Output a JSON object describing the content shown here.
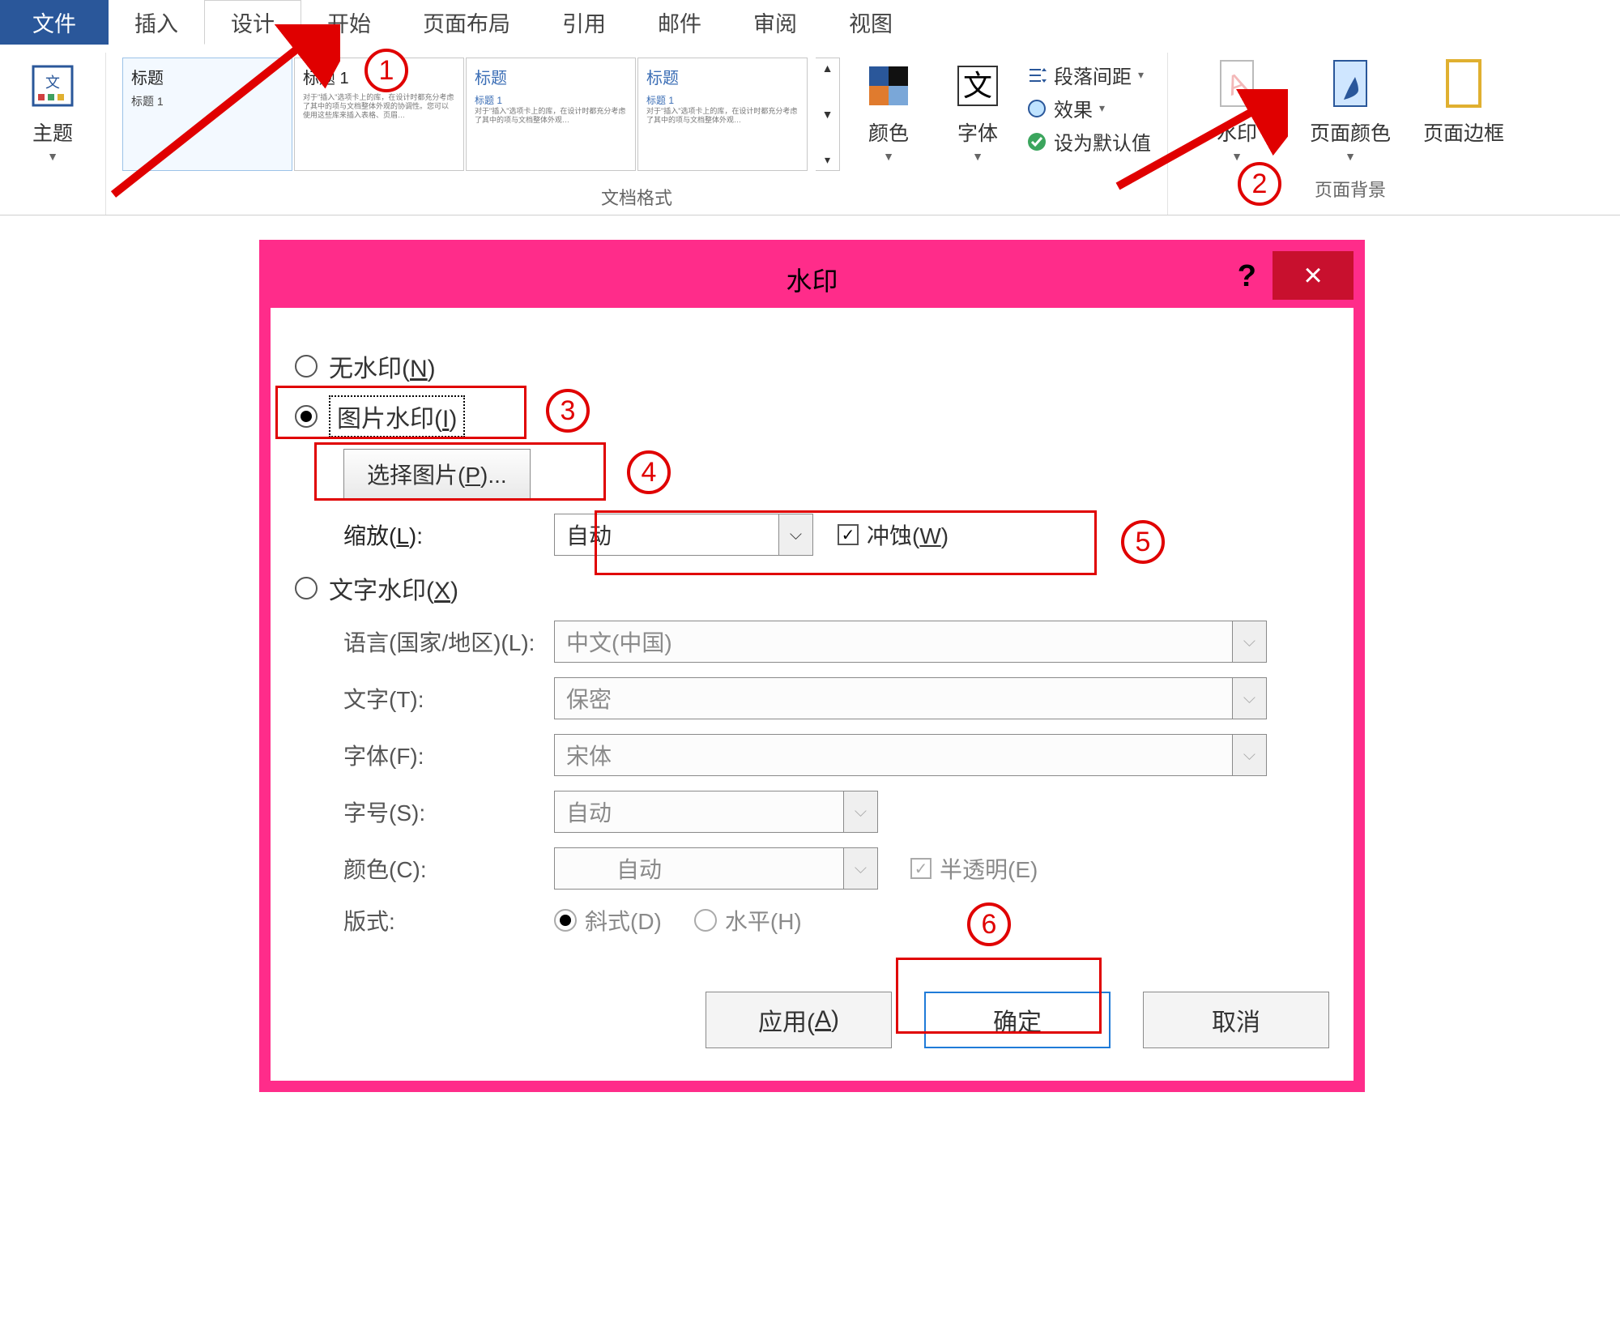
{
  "ribbon": {
    "tabs": {
      "file": "文件",
      "insert": "插入",
      "design": "设计",
      "start": "开始",
      "layout": "页面布局",
      "ref": "引用",
      "mail": "邮件",
      "review": "审阅",
      "view": "视图"
    },
    "themes_label": "主题",
    "doc_style_hdr": "标题",
    "doc_style_sub": "标题 1",
    "doc_format_group": "文档格式",
    "colors": "颜色",
    "fonts": "字体",
    "spacing": "段落间距",
    "effects": "效果",
    "default": "设为默认值",
    "watermark": "水印",
    "pagecolor": "页面颜色",
    "pageborder": "页面边框",
    "pagebg_group": "页面背景"
  },
  "annotations": {
    "n1": "1",
    "n2": "2",
    "n3": "3",
    "n4": "4",
    "n5": "5",
    "n6": "6"
  },
  "dialog": {
    "title": "水印",
    "help": "?",
    "close": "×",
    "no_wm": "无水印(N)",
    "pic_wm": "图片水印(I)",
    "select_pic": "选择图片(P)...",
    "scale_lbl": "缩放(L):",
    "scale_val": "自动",
    "washout": "冲蚀(W)",
    "txt_wm": "文字水印(X)",
    "lang_lbl": "语言(国家/地区)(L):",
    "lang_val": "中文(中国)",
    "text_lbl": "文字(T):",
    "text_val": "保密",
    "font_lbl": "字体(F):",
    "font_val": "宋体",
    "size_lbl": "字号(S):",
    "size_val": "自动",
    "color_lbl": "颜色(C):",
    "color_val": "自动",
    "semi": "半透明(E)",
    "layout_lbl": "版式:",
    "diag": "斜式(D)",
    "horiz": "水平(H)",
    "apply": "应用(A)",
    "ok": "确定",
    "cancel": "取消"
  }
}
